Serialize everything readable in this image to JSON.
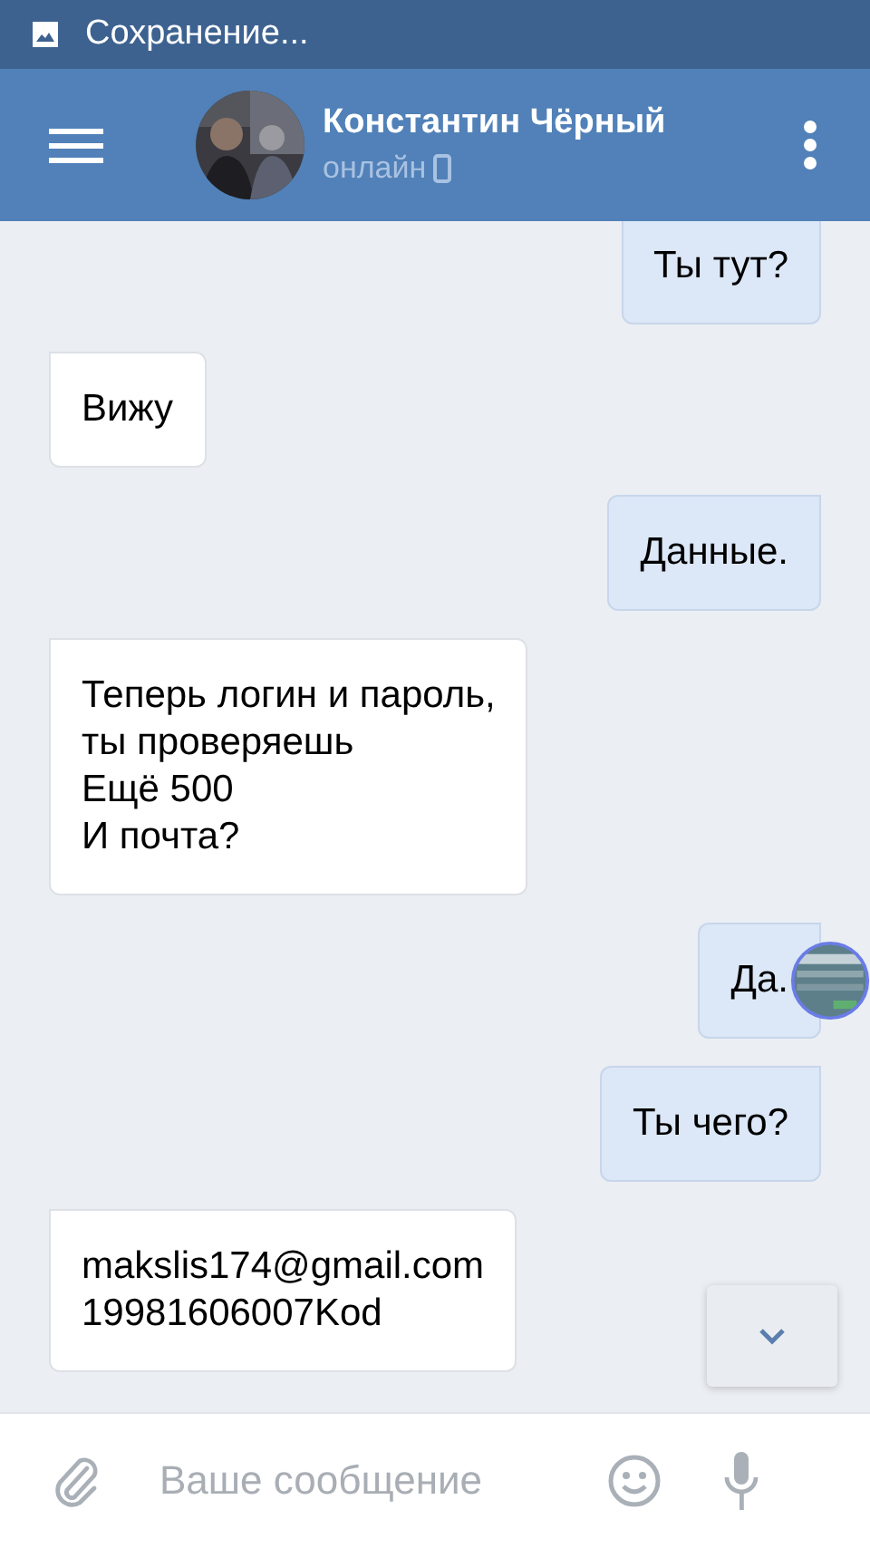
{
  "status_bar": {
    "notification": "Сохранение..."
  },
  "header": {
    "name": "Константин Чёрный",
    "status": "онлайн"
  },
  "messages": [
    {
      "kind": "out",
      "lines": [
        "Ты тут?"
      ]
    },
    {
      "kind": "in",
      "lines": [
        "Вижу"
      ]
    },
    {
      "kind": "out",
      "lines": [
        "Данные."
      ]
    },
    {
      "kind": "in",
      "lines": [
        "Теперь логин и пароль,",
        "ты проверяешь",
        "Ещё 500",
        "И почта?"
      ]
    },
    {
      "kind": "out",
      "lines": [
        "Да."
      ],
      "overlay": true
    },
    {
      "kind": "out",
      "lines": [
        "Ты чего?"
      ]
    },
    {
      "kind": "in",
      "lines": [
        "makslis174@gmail.com",
        "19981606007Kod"
      ]
    }
  ],
  "composer": {
    "placeholder": "Ваше сообщение"
  }
}
